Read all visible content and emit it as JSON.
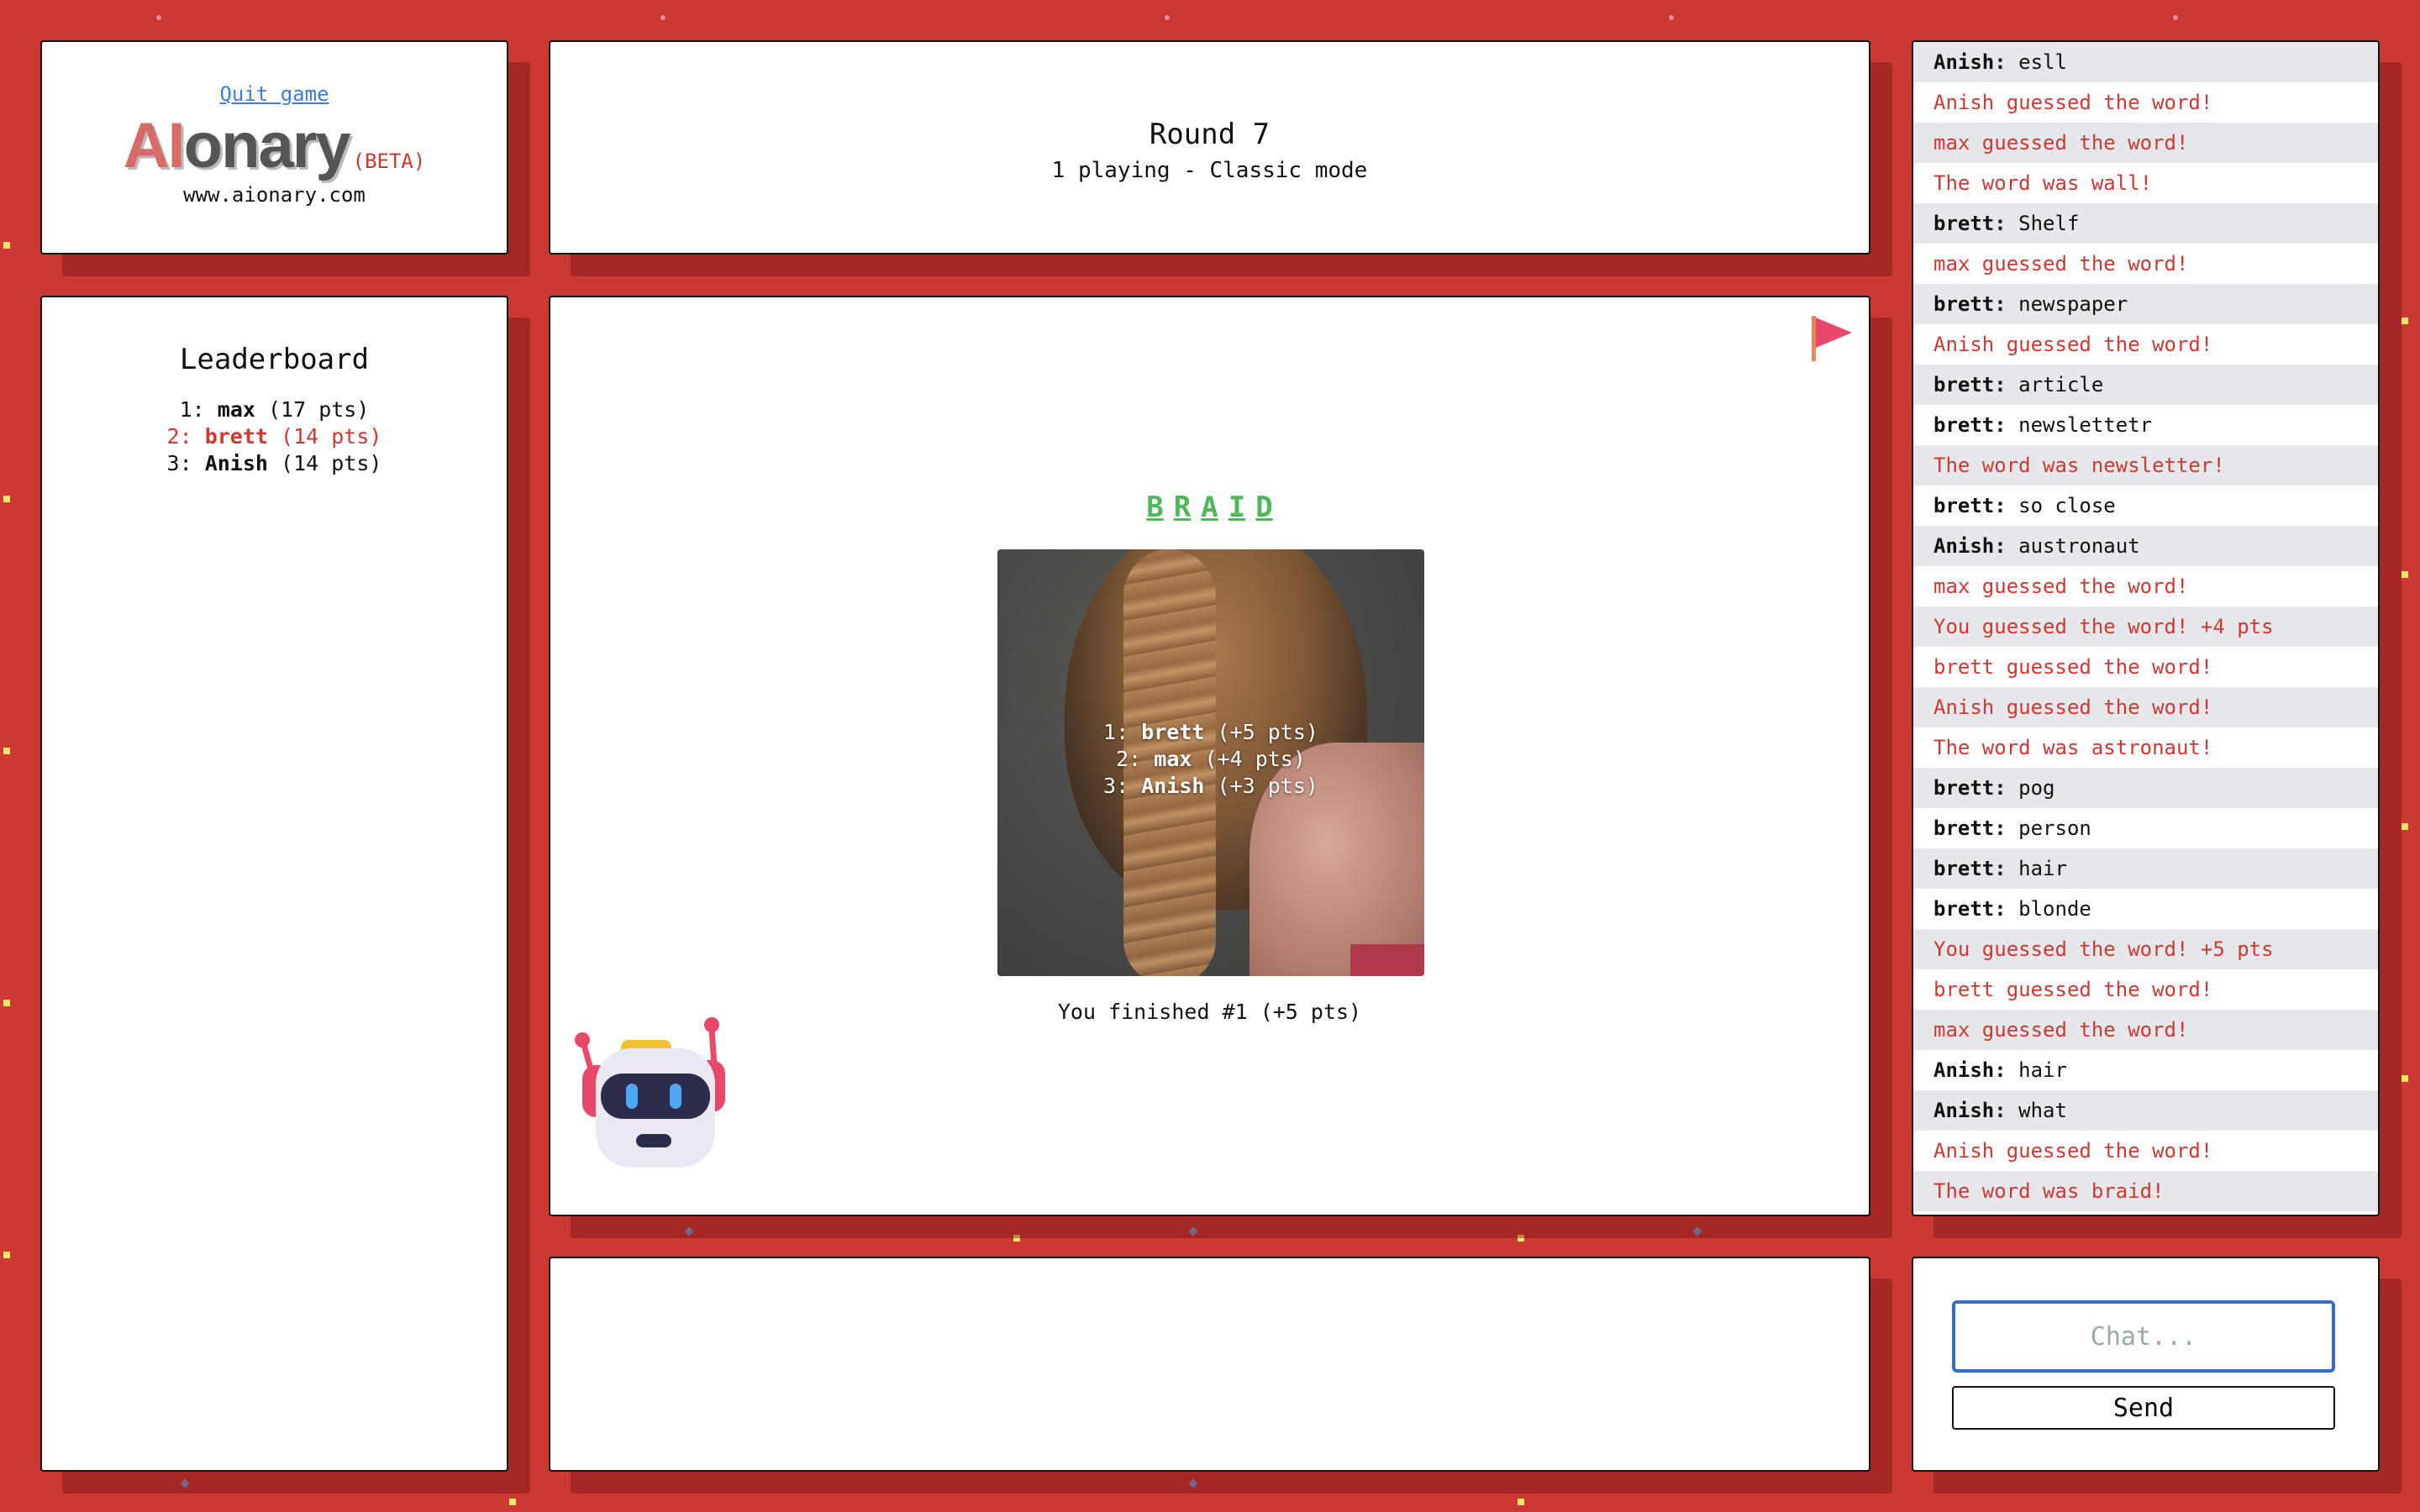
{
  "logo_panel": {
    "quit_label": "Quit game",
    "logo_ai": "AI",
    "logo_rest": "onary",
    "beta": "(BETA)",
    "site": "www.aionary.com"
  },
  "round": {
    "title": "Round 7",
    "subtitle": "1 playing - Classic mode"
  },
  "leaderboard": {
    "title": "Leaderboard",
    "rows": [
      {
        "rank": "1:",
        "name": "max",
        "pts": "(17 pts)",
        "me": false
      },
      {
        "rank": "2:",
        "name": "brett",
        "pts": "(14 pts)",
        "me": true
      },
      {
        "rank": "3:",
        "name": "Anish",
        "pts": "(14 pts)",
        "me": false
      }
    ]
  },
  "main": {
    "word_letters": [
      "B",
      "R",
      "A",
      "I",
      "D"
    ],
    "results": [
      {
        "rank": "1:",
        "name": "brett",
        "pts": "(+5 pts)"
      },
      {
        "rank": "2:",
        "name": "max",
        "pts": "(+4 pts)"
      },
      {
        "rank": "3:",
        "name": "Anish",
        "pts": "(+3 pts)"
      }
    ],
    "finished": "You finished #1 (+5 pts)",
    "flag_icon": "report-flag-icon",
    "robot_icon": "robot-mascot-icon",
    "accent_color": "#4fb858"
  },
  "chat": [
    {
      "who": "Anish:",
      "text": "esll",
      "sys": false
    },
    {
      "who": "",
      "text": "Anish guessed the word!",
      "sys": true
    },
    {
      "who": "",
      "text": "max guessed the word!",
      "sys": true
    },
    {
      "who": "",
      "text": "The word was wall!",
      "sys": true
    },
    {
      "who": "brett:",
      "text": "Shelf",
      "sys": false
    },
    {
      "who": "",
      "text": "max guessed the word!",
      "sys": true
    },
    {
      "who": "brett:",
      "text": "newspaper",
      "sys": false
    },
    {
      "who": "",
      "text": "Anish guessed the word!",
      "sys": true
    },
    {
      "who": "brett:",
      "text": "article",
      "sys": false
    },
    {
      "who": "brett:",
      "text": "newslettetr",
      "sys": false
    },
    {
      "who": "",
      "text": "The word was newsletter!",
      "sys": true
    },
    {
      "who": "brett:",
      "text": "so close",
      "sys": false
    },
    {
      "who": "Anish:",
      "text": "austronaut",
      "sys": false
    },
    {
      "who": "",
      "text": "max guessed the word!",
      "sys": true
    },
    {
      "who": "",
      "text": "You guessed the word! +4 pts",
      "sys": true
    },
    {
      "who": "",
      "text": "brett guessed the word!",
      "sys": true
    },
    {
      "who": "",
      "text": "Anish guessed the word!",
      "sys": true
    },
    {
      "who": "",
      "text": "The word was astronaut!",
      "sys": true
    },
    {
      "who": "brett:",
      "text": "pog",
      "sys": false
    },
    {
      "who": "brett:",
      "text": "person",
      "sys": false
    },
    {
      "who": "brett:",
      "text": "hair",
      "sys": false
    },
    {
      "who": "brett:",
      "text": "blonde",
      "sys": false
    },
    {
      "who": "",
      "text": "You guessed the word! +5 pts",
      "sys": true
    },
    {
      "who": "",
      "text": "brett guessed the word!",
      "sys": true
    },
    {
      "who": "",
      "text": "max guessed the word!",
      "sys": true
    },
    {
      "who": "Anish:",
      "text": "hair",
      "sys": false
    },
    {
      "who": "Anish:",
      "text": "what",
      "sys": false
    },
    {
      "who": "",
      "text": "Anish guessed the word!",
      "sys": true
    },
    {
      "who": "",
      "text": "The word was braid!",
      "sys": true
    }
  ],
  "input": {
    "placeholder": "Chat...",
    "send_label": "Send"
  },
  "colors": {
    "background": "#cc3932",
    "system_message": "#cc3932",
    "input_border": "#2f6ed0"
  }
}
